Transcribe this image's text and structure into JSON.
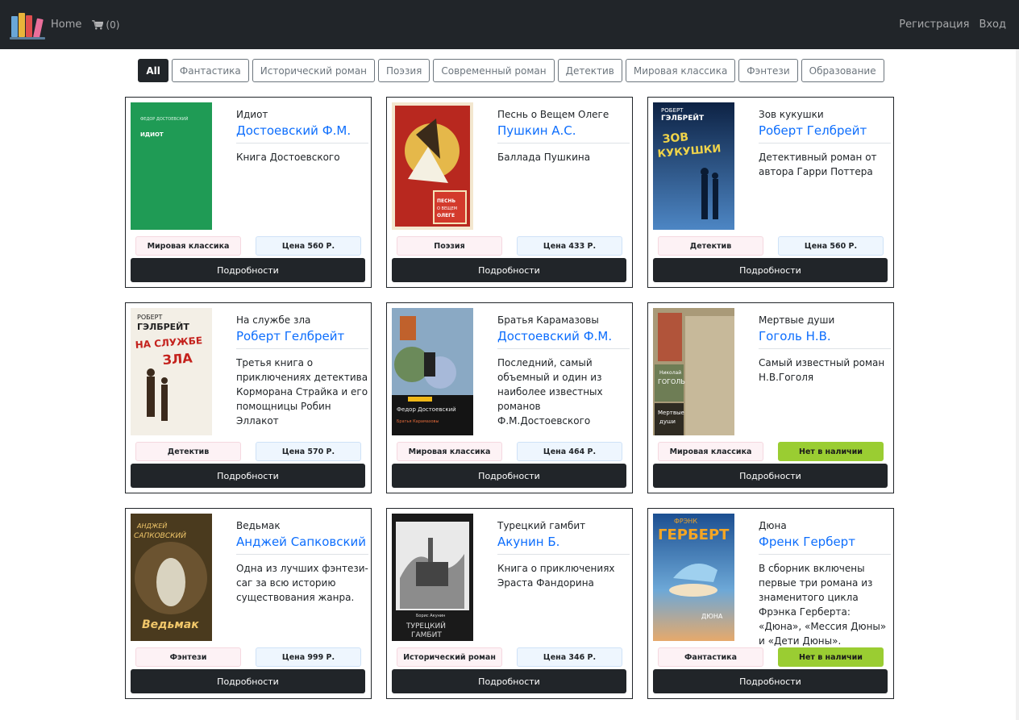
{
  "nav": {
    "home": "Home",
    "cart_count": "(0)",
    "register": "Регистрация",
    "login": "Вход"
  },
  "filters": [
    "All",
    "Фантастика",
    "Исторический роман",
    "Поэзия",
    "Современный роман",
    "Детектив",
    "Мировая классика",
    "Фэнтези",
    "Образование"
  ],
  "active_filter": "All",
  "details_label": "Подробности",
  "books": [
    {
      "title": "Идиот",
      "author": "Достоевский Ф.М.",
      "desc": "Книга Достоевского",
      "genre": "Мировая классика",
      "price": "Цена 560 Р.",
      "cover_lines": [
        "ФЕДОР ДОСТОЕВСКИЙ",
        "ИДИОТ"
      ],
      "cover_color": "#1f9b55"
    },
    {
      "title": "Песнь о Вещем Олеге",
      "author": "Пушкин А.С.",
      "desc": "Баллада Пушкина",
      "genre": "Поэзия",
      "price": "Цена 433 Р.",
      "cover_lines": [
        "ПЕСНЬ",
        "О ВЕЩЕМ",
        "ОЛЕГЕ"
      ],
      "cover_color": "#b8281f"
    },
    {
      "title": "Зов кукушки",
      "author": "Роберт Гелбрейт",
      "desc": "Детективный роман от автора Гарри Поттера",
      "genre": "Детектив",
      "price": "Цена 560 Р.",
      "cover_lines": [
        "РОБЕРТ",
        "ГЭЛБРЕЙТ",
        "ЗОВ",
        "КУКУШКИ"
      ],
      "cover_color": "#17356b"
    },
    {
      "title": "На службе зла",
      "author": "Роберт Гелбрейт",
      "desc": "Третья книга о приключениях детектива Корморана Страйка и его помощницы Робин Эллакот",
      "genre": "Детектив",
      "price": "Цена 570 Р.",
      "cover_lines": [
        "РОБЕРТ",
        "ГЭЛБРЕЙТ",
        "НА СЛУЖБЕ",
        "ЗЛА"
      ],
      "cover_color": "#f3efe6"
    },
    {
      "title": "Братья Карамазовы",
      "author": "Достоевский Ф.М.",
      "desc": "Последний, самый объемный и один из наиболее известных романов Ф.М.Достоевского",
      "genre": "Мировая классика",
      "price": "Цена 464 Р.",
      "cover_lines": [
        "Федор Достоевский",
        "Братья Карамазовы"
      ],
      "cover_color": "#3e6d8a"
    },
    {
      "title": "Мертвые души",
      "author": "Гоголь Н.В.",
      "desc": "Самый известный роман Н.В.Гоголя",
      "genre": "Мировая классика",
      "price": "Нет в наличии",
      "cover_lines": [
        "Николай",
        "ГОГОЛЬ",
        "Мертвые",
        "души"
      ],
      "cover_color": "#a99a78"
    },
    {
      "title": "Ведьмак",
      "author": "Анджей Сапковский",
      "desc": "Одна из лучших фэнтези-саг за всю историю существования жанра.",
      "genre": "Фэнтези",
      "price": "Цена 999 Р.",
      "cover_lines": [
        "АНДЖЕЙ",
        "САПКОВСКИЙ",
        "Ведьмак"
      ],
      "cover_color": "#4a3a1e"
    },
    {
      "title": "Турецкий гамбит",
      "author": "Акунин Б.",
      "desc": "Книга о приключениях Эраста Фандорина",
      "genre": "Исторический роман",
      "price": "Цена 346 Р.",
      "cover_lines": [
        "Борис Акунин",
        "ТУРЕЦКИЙ",
        "ГАМБИТ"
      ],
      "cover_color": "#e9e9e9"
    },
    {
      "title": "Дюна",
      "author": "Френк Герберт",
      "desc": "В сборник включены первые три романа из знаменитого цикла Фрэнка Герберта: «Дюна», «Мессия Дюны» и «Дети Дюны».",
      "genre": "Фантастика",
      "price": "Нет в наличии",
      "cover_lines": [
        "ФРЭНК",
        "ГЕРБЕРТ",
        "ДЮНА"
      ],
      "cover_color": "#2a6cb0"
    }
  ],
  "colors": {
    "navbar": "#212529",
    "link": "#0d6efd",
    "out_of_stock": "#9acd32"
  }
}
